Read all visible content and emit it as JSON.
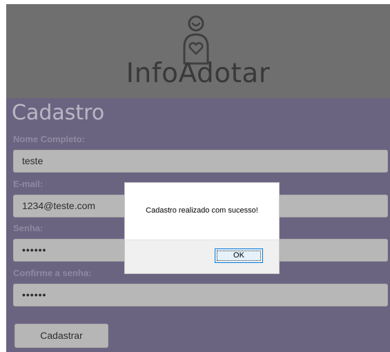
{
  "app": {
    "brand": "InfoAdotar"
  },
  "icons": {
    "logo": "adoption-heart-person-icon"
  },
  "form": {
    "title": "Cadastro",
    "fields": [
      {
        "label": "Nome Completo:",
        "value": "teste"
      },
      {
        "label": "E-mail:",
        "value": "1234@teste.com"
      },
      {
        "label": "Senha:",
        "value": "••••••"
      },
      {
        "label": "Confirme a senha:",
        "value": "••••••"
      }
    ],
    "submit_label": "Cadastrar"
  },
  "dialog": {
    "message": "Cadastro realizado com sucesso!",
    "ok_label": "OK"
  },
  "colors": {
    "overlay_gray": "#6e6e6e",
    "form_panel": "#6b6481",
    "dialog_focus": "#0078d7"
  }
}
